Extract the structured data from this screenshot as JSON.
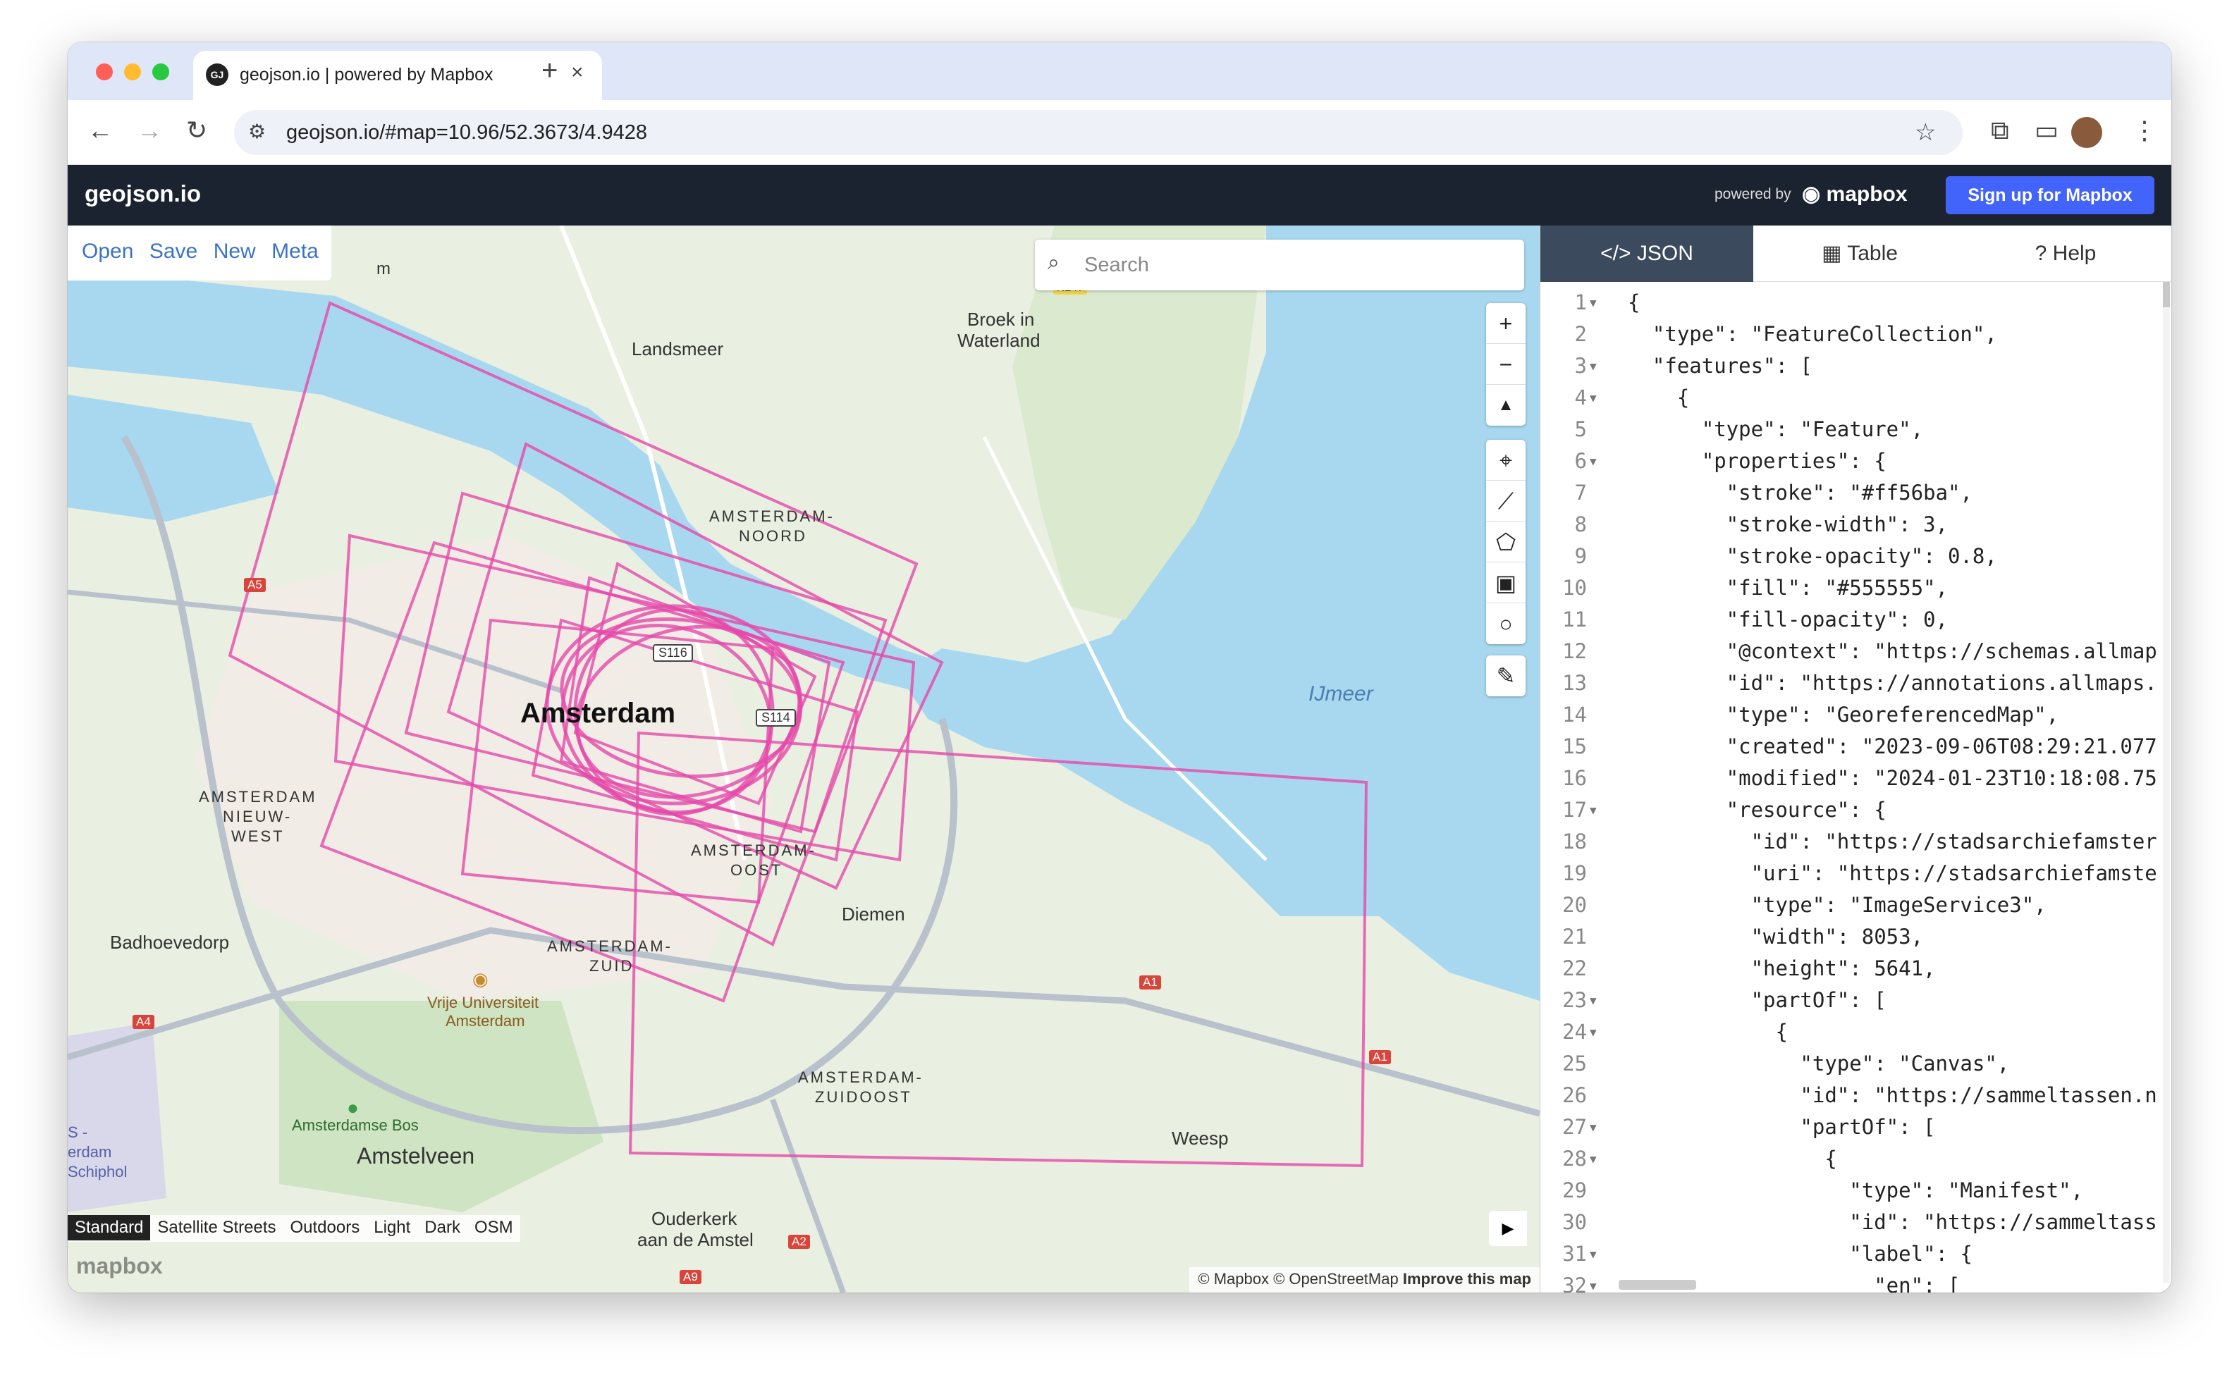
{
  "browser": {
    "tab_title": "geojson.io | powered by Mapbox",
    "tab_favicon": "GJ",
    "url": "geojson.io/#map=10.96/52.3673/4.9428"
  },
  "header": {
    "brand": "geojson.io",
    "powered_by": "powered by",
    "mapbox_logo": "mapbox",
    "signup_label": "Sign up for Mapbox"
  },
  "file_menu": [
    "Open",
    "Save",
    "New",
    "Meta"
  ],
  "search": {
    "placeholder": "Search"
  },
  "map_styles": {
    "items": [
      "Standard",
      "Satellite Streets",
      "Outdoors",
      "Light",
      "Dark",
      "OSM"
    ],
    "selected": "Standard"
  },
  "attribution": {
    "text": "© Mapbox © OpenStreetMap",
    "improve": "Improve this map"
  },
  "watermark": "mapbox",
  "map_labels": [
    "Landsmeer",
    "Broek in",
    "Waterland",
    "AMSTERDAM-",
    "NOORD",
    "Amsterdam",
    "AMSTERDAM",
    "NIEUW-",
    "WEST",
    "AMSTERDAM-",
    "OOST",
    "Diemen",
    "IJmeer",
    "Badhoevedorp",
    "AMSTERDAM-",
    "ZUID",
    "Vrije Universiteit",
    "Amsterdam",
    "Amsterdamse Bos",
    "Amstelveen",
    "AMSTERDAM-",
    "ZUIDOOST",
    "Weesp",
    "Ouderkerk",
    "aan de Amstel",
    "S116",
    "S114",
    "A5",
    "A4",
    "A1",
    "A1",
    "A2",
    "A9",
    "N247",
    "S -",
    "erdam",
    "Schiphol",
    "m"
  ],
  "panel": {
    "tabs": [
      {
        "label": "JSON",
        "icon": "code-icon",
        "active": true
      },
      {
        "label": "Table",
        "icon": "table-icon",
        "active": false
      },
      {
        "label": "Help",
        "icon": "help-icon",
        "active": false
      }
    ]
  },
  "editor": {
    "lines": [
      {
        "n": "1",
        "fold": true,
        "text": "{"
      },
      {
        "n": "2",
        "fold": false,
        "text": "  \"type\": \"FeatureCollection\","
      },
      {
        "n": "3",
        "fold": true,
        "text": "  \"features\": ["
      },
      {
        "n": "4",
        "fold": true,
        "text": "    {"
      },
      {
        "n": "5",
        "fold": false,
        "text": "      \"type\": \"Feature\","
      },
      {
        "n": "6",
        "fold": true,
        "text": "      \"properties\": {"
      },
      {
        "n": "7",
        "fold": false,
        "text": "        \"stroke\": \"#ff56ba\","
      },
      {
        "n": "8",
        "fold": false,
        "text": "        \"stroke-width\": 3,"
      },
      {
        "n": "9",
        "fold": false,
        "text": "        \"stroke-opacity\": 0.8,"
      },
      {
        "n": "10",
        "fold": false,
        "text": "        \"fill\": \"#555555\","
      },
      {
        "n": "11",
        "fold": false,
        "text": "        \"fill-opacity\": 0,"
      },
      {
        "n": "12",
        "fold": false,
        "text": "        \"@context\": \"https://schemas.allmap"
      },
      {
        "n": "13",
        "fold": false,
        "text": "        \"id\": \"https://annotations.allmaps."
      },
      {
        "n": "14",
        "fold": false,
        "text": "        \"type\": \"GeoreferencedMap\","
      },
      {
        "n": "15",
        "fold": false,
        "text": "        \"created\": \"2023-09-06T08:29:21.077"
      },
      {
        "n": "16",
        "fold": false,
        "text": "        \"modified\": \"2024-01-23T10:18:08.75"
      },
      {
        "n": "17",
        "fold": true,
        "text": "        \"resource\": {"
      },
      {
        "n": "18",
        "fold": false,
        "text": "          \"id\": \"https://stadsarchiefamster"
      },
      {
        "n": "19",
        "fold": false,
        "text": "          \"uri\": \"https://stadsarchiefamste"
      },
      {
        "n": "20",
        "fold": false,
        "text": "          \"type\": \"ImageService3\","
      },
      {
        "n": "21",
        "fold": false,
        "text": "          \"width\": 8053,"
      },
      {
        "n": "22",
        "fold": false,
        "text": "          \"height\": 5641,"
      },
      {
        "n": "23",
        "fold": true,
        "text": "          \"partOf\": ["
      },
      {
        "n": "24",
        "fold": true,
        "text": "            {"
      },
      {
        "n": "25",
        "fold": false,
        "text": "              \"type\": \"Canvas\","
      },
      {
        "n": "26",
        "fold": false,
        "text": "              \"id\": \"https://sammeltassen.n"
      },
      {
        "n": "27",
        "fold": true,
        "text": "              \"partOf\": ["
      },
      {
        "n": "28",
        "fold": true,
        "text": "                {"
      },
      {
        "n": "29",
        "fold": false,
        "text": "                  \"type\": \"Manifest\","
      },
      {
        "n": "30",
        "fold": false,
        "text": "                  \"id\": \"https://sammeltass"
      },
      {
        "n": "31",
        "fold": true,
        "text": "                  \"label\": {"
      },
      {
        "n": "32",
        "fold": true,
        "text": "                    \"en\": ["
      }
    ]
  },
  "colors": {
    "accent": "#ff56ba",
    "header_bg": "#1b2230",
    "signup_bg": "#4264fb",
    "active_tab_bg": "#3c4a5e",
    "water": "#a8d8f0",
    "land": "#e9efe1"
  }
}
